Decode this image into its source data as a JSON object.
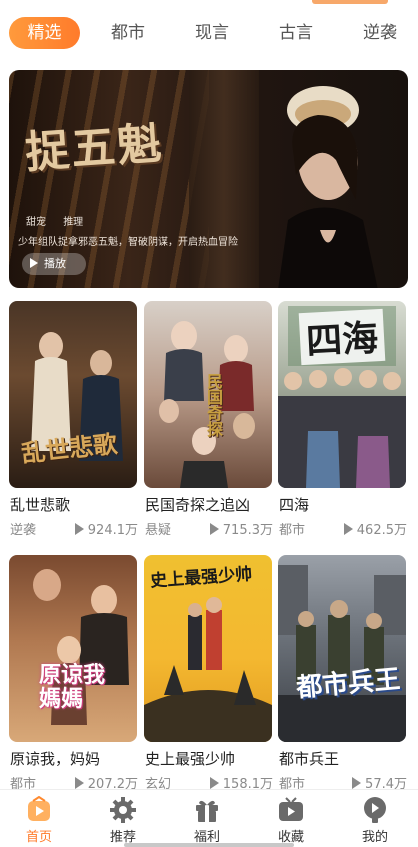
{
  "tabs": [
    {
      "label": "精选",
      "active": true
    },
    {
      "label": "都市",
      "active": false
    },
    {
      "label": "现言",
      "active": false
    },
    {
      "label": "古言",
      "active": false
    },
    {
      "label": "逆袭",
      "active": false
    }
  ],
  "banner": {
    "title_art": "捉五魁",
    "tags": [
      "甜宠",
      "推理"
    ],
    "description": "少年组队捉拿邪恶五魁，智破阴谋，开启热血冒险",
    "play_label": "播放"
  },
  "dramas": [
    {
      "title": "乱世悲歌",
      "genre": "逆袭",
      "views": "924.1万",
      "poster_text": "乱世悲歌"
    },
    {
      "title": "民国奇探之追凶",
      "genre": "悬疑",
      "views": "715.3万",
      "poster_text": "民国奇探"
    },
    {
      "title": "四海",
      "genre": "都市",
      "views": "462.5万",
      "poster_text": "四海"
    },
    {
      "title": "原谅我，妈妈",
      "genre": "都市",
      "views": "207.2万",
      "poster_text": "原谅我媽媽"
    },
    {
      "title": "史上最强少帅",
      "genre": "玄幻",
      "views": "158.1万",
      "poster_text": "史上最强少帅"
    },
    {
      "title": "都市兵王",
      "genre": "都市",
      "views": "57.4万",
      "poster_text": "都市兵王"
    }
  ],
  "bottom_nav": [
    {
      "label": "首页",
      "icon": "home-icon",
      "active": true
    },
    {
      "label": "推荐",
      "icon": "gear-icon",
      "active": false
    },
    {
      "label": "福利",
      "icon": "gift-icon",
      "active": false
    },
    {
      "label": "收藏",
      "icon": "tv-icon",
      "active": false
    },
    {
      "label": "我的",
      "icon": "profile-icon",
      "active": false
    }
  ],
  "colors": {
    "accent": "#ff7b2b",
    "accent_light": "#ff9a3c",
    "text_primary": "#222222",
    "text_secondary": "#8a8a8a"
  }
}
